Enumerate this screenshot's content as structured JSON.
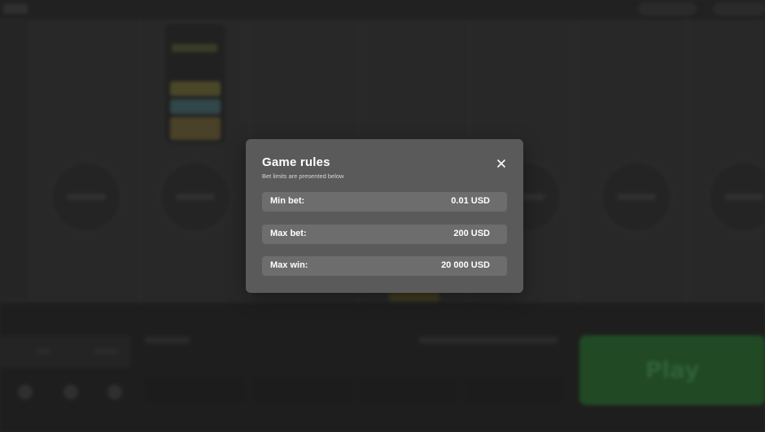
{
  "modal": {
    "title": "Game rules",
    "subtitle": "Bet limits are presented below",
    "close_icon": "close-icon",
    "rows": [
      {
        "label": "Min bet:",
        "value": "0.01 USD"
      },
      {
        "label": "Max bet:",
        "value": "200 USD"
      },
      {
        "label": "Max win:",
        "value": "20 000 USD"
      }
    ]
  },
  "background": {
    "play_label": "Play",
    "colors": {
      "play_button": "#255e2a",
      "modal_bg": "#5a5a5a",
      "row_bg": "#6d6d6d"
    }
  }
}
